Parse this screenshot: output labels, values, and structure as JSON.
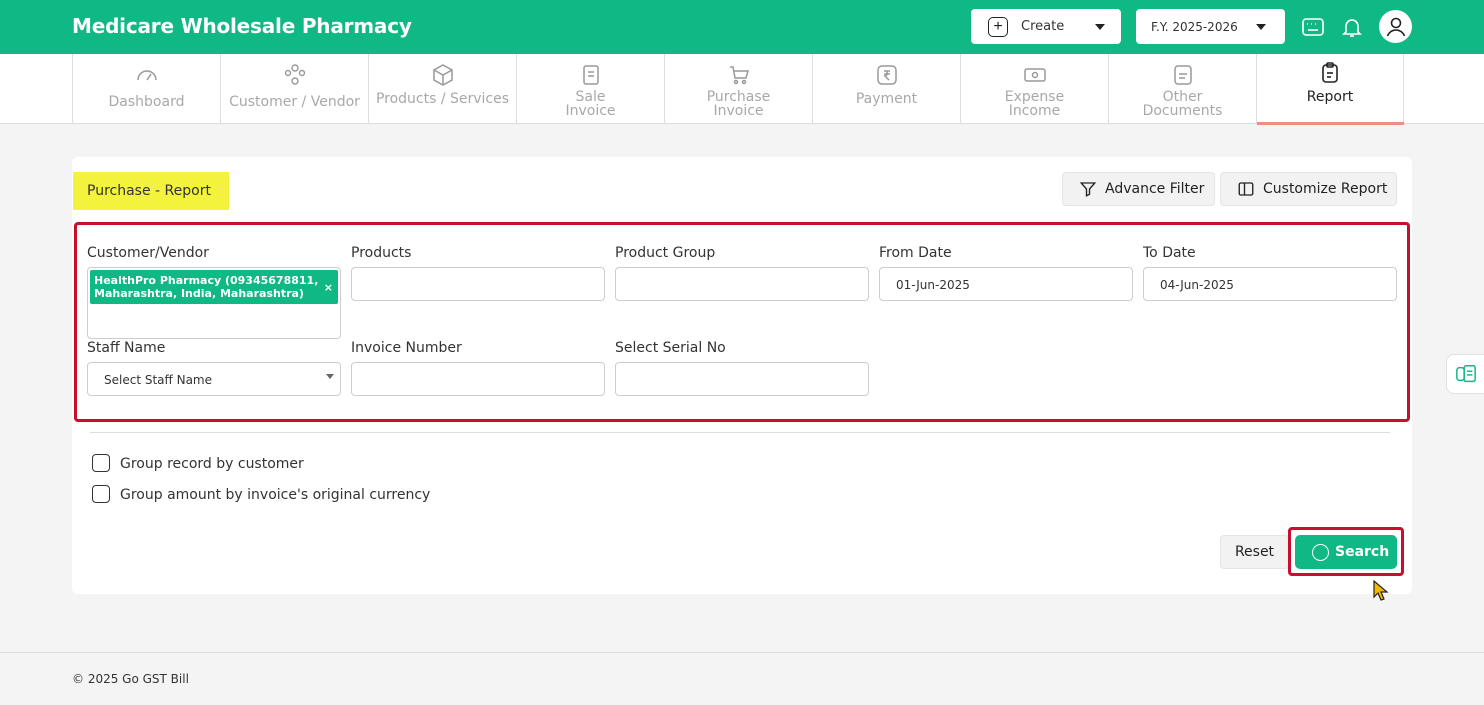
{
  "header": {
    "app_title": "Medicare Wholesale Pharmacy",
    "create_label": "Create",
    "fy_label": "F.Y. 2025-2026",
    "brand_color": "#0fb885"
  },
  "nav": {
    "items": [
      {
        "label": "Dashboard",
        "icon": "gauge-icon"
      },
      {
        "label": "Customer / Vendor",
        "icon": "people-icon"
      },
      {
        "label": "Products / Services",
        "icon": "box-icon"
      },
      {
        "label": "Sale Invoice",
        "icon": "invoice-icon"
      },
      {
        "label": "Purchase Invoice",
        "icon": "cart-icon"
      },
      {
        "label": "Payment",
        "icon": "rupee-icon"
      },
      {
        "label": "Expense Income",
        "icon": "cash-icon"
      },
      {
        "label": "Other Documents",
        "icon": "document-icon"
      },
      {
        "label": "Report",
        "icon": "clipboard-icon"
      }
    ],
    "active": "Report"
  },
  "page": {
    "title": "Purchase - Report",
    "advance_filter_label": "Advance Filter",
    "customize_report_label": "Customize Report"
  },
  "filters": {
    "customer_vendor_label": "Customer/Vendor",
    "customer_vendor_tag_line1": "HealthPro Pharmacy (09345678811,",
    "customer_vendor_tag_line2": "Maharashtra, India, Maharashtra)",
    "tag_remove": "×",
    "products_label": "Products",
    "product_group_label": "Product Group",
    "from_date_label": "From Date",
    "from_date_value": "01-Jun-2025",
    "to_date_label": "To Date",
    "to_date_value": "04-Jun-2025",
    "staff_name_label": "Staff Name",
    "staff_name_value": "Select Staff Name",
    "invoice_number_label": "Invoice Number",
    "serial_no_label": "Select Serial No"
  },
  "options": {
    "group_by_customer": "Group record by customer",
    "group_by_currency": "Group amount by invoice's original currency"
  },
  "actions": {
    "reset_label": "Reset",
    "search_label": "Search"
  },
  "footer": {
    "copyright": "© 2025 Go GST Bill"
  }
}
